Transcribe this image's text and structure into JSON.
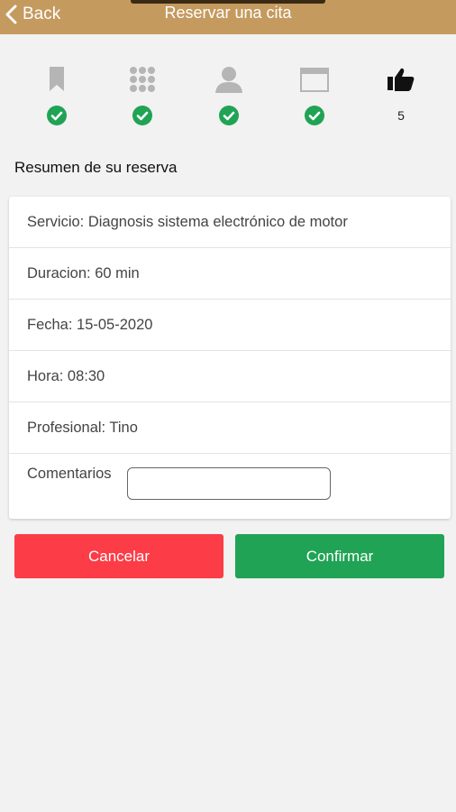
{
  "header": {
    "back_label": "Back",
    "title": "Reservar una cita"
  },
  "steps": [
    {
      "icon": "bookmark-icon",
      "status": "done"
    },
    {
      "icon": "grid-icon",
      "status": "done"
    },
    {
      "icon": "user-icon",
      "status": "done"
    },
    {
      "icon": "calendar-icon",
      "status": "done"
    },
    {
      "icon": "thumbs-up-icon",
      "status": "current",
      "number": "5"
    }
  ],
  "summary": {
    "title": "Resumen de su reserva",
    "servicio": "Servicio: Diagnosis sistema electrónico de motor",
    "duracion": "Duracion: 60 min",
    "fecha": "Fecha: 15-05-2020",
    "hora": "Hora: 08:30",
    "profesional": "Profesional: Tino",
    "comentarios_label": "Comentarios",
    "comentarios_value": ""
  },
  "actions": {
    "cancel_label": "Cancelar",
    "confirm_label": "Confirmar"
  },
  "colors": {
    "header": "#c49a5e",
    "done": "#20a355",
    "cancel": "#fc3c46",
    "confirm": "#20a355",
    "inactive_icon": "#b5b5b5"
  }
}
